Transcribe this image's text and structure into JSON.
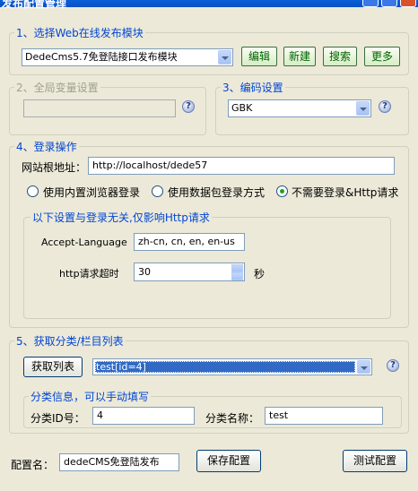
{
  "window": {
    "title": "发布配置管理"
  },
  "section1": {
    "legend": "1、选择Web在线发布模块",
    "module_select": "DedeCms5.7免登陆接口发布模块",
    "edit_label": "编辑",
    "new_label": "新建",
    "search_label": "搜索",
    "more_label": "更多"
  },
  "section2": {
    "legend": "2、全局变量设置",
    "value": ""
  },
  "section3": {
    "legend": "3、编码设置",
    "encoding": "GBK"
  },
  "section4": {
    "legend": "4、登录操作",
    "site_root_label": "网站根地址：",
    "site_root_value": "http://localhost/dede57",
    "radio_builtin": "使用内置浏览器登录",
    "radio_packet": "使用数据包登录方式",
    "radio_none": "不需要登录&Http请求",
    "sub_legend": "以下设置与登录无关,仅影响Http请求",
    "accept_language_label": "Accept-Language",
    "accept_language_value": "zh-cn, cn, en, en-us",
    "timeout_label": "http请求超时",
    "timeout_value": "30",
    "timeout_unit": "秒"
  },
  "section5": {
    "legend": "5、获取分类/栏目列表",
    "fetch_label": "获取列表",
    "category_select": "test[id=4]",
    "sub_legend": "分类信息，可以手动填写",
    "cat_id_label": "分类ID号：",
    "cat_id_value": "4",
    "cat_name_label": "分类名称：",
    "cat_name_value": "test"
  },
  "footer": {
    "config_name_label": "配置名：",
    "config_name_value": "dedeCMS免登陆发布",
    "save_label": "保存配置",
    "test_label": "测试配置"
  }
}
